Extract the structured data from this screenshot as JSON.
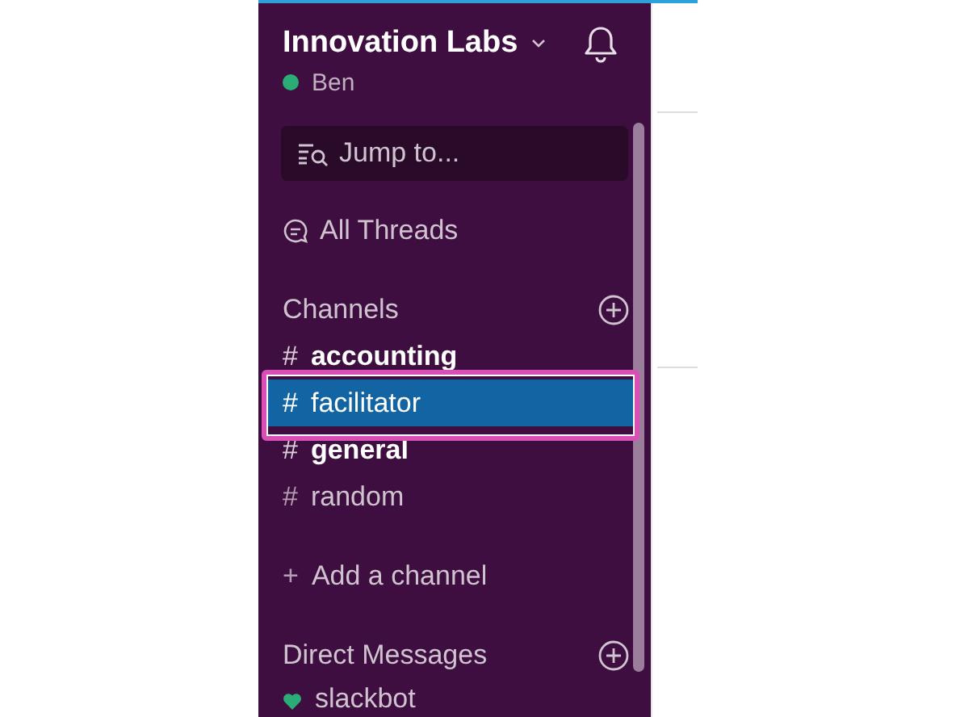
{
  "workspace": {
    "name": "Innovation Labs",
    "user": "Ben"
  },
  "search": {
    "placeholder": "Jump to..."
  },
  "threads": {
    "label": "All Threads"
  },
  "channels_header": "Channels",
  "channels": [
    {
      "icon": "#",
      "name": "accounting",
      "unread": true,
      "selected": false
    },
    {
      "icon": "#",
      "name": "facilitator",
      "unread": false,
      "selected": true
    },
    {
      "icon": "#",
      "name": "general",
      "unread": true,
      "selected": false
    },
    {
      "icon": "#",
      "name": "random",
      "unread": false,
      "selected": false
    }
  ],
  "add_channel": {
    "icon": "+",
    "label": "Add a channel"
  },
  "dm_header": "Direct Messages",
  "direct_messages": [
    {
      "name": "slackbot"
    }
  ]
}
